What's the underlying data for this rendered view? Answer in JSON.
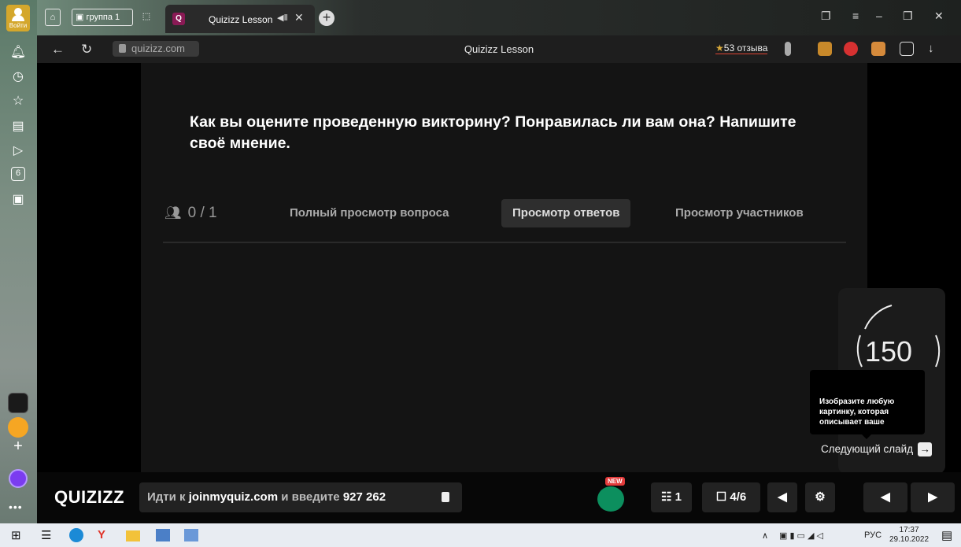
{
  "rail": {
    "login_label": "Войти"
  },
  "tabs": {
    "group_tab_label": "группа 1",
    "active_tab_title": "Quizizz Lesson",
    "active_tab_badge": "Q"
  },
  "address_bar": {
    "url": "quizizz.com",
    "page_title": "Quizizz Lesson",
    "reviews": "53 отзыва"
  },
  "quiz": {
    "question": "Как вы оцените проведенную викторину? Понравилась ли вам она? Напишите своё мнение.",
    "responses_count": "0 / 1",
    "tabs": [
      {
        "label": "Полный просмотр вопроса"
      },
      {
        "label": "Просмотр ответов"
      },
      {
        "label": "Просмотр участников"
      }
    ],
    "timer_value": "150",
    "next_slide_preview": "Изобразите любую картинку, которая описывает ваше",
    "next_slide_label": "Следующий слайд"
  },
  "bottom_bar": {
    "logo": "QUIZIZZ",
    "join_prefix": "Идти к",
    "join_url": "joinmyquiz.com",
    "join_middle": "и введите",
    "join_code": "927 262",
    "new_badge": "NEW",
    "participants": "1",
    "slide_progress": "4/6"
  },
  "taskbar": {
    "language": "РУС",
    "time": "17:37",
    "date": "29.10.2022"
  }
}
